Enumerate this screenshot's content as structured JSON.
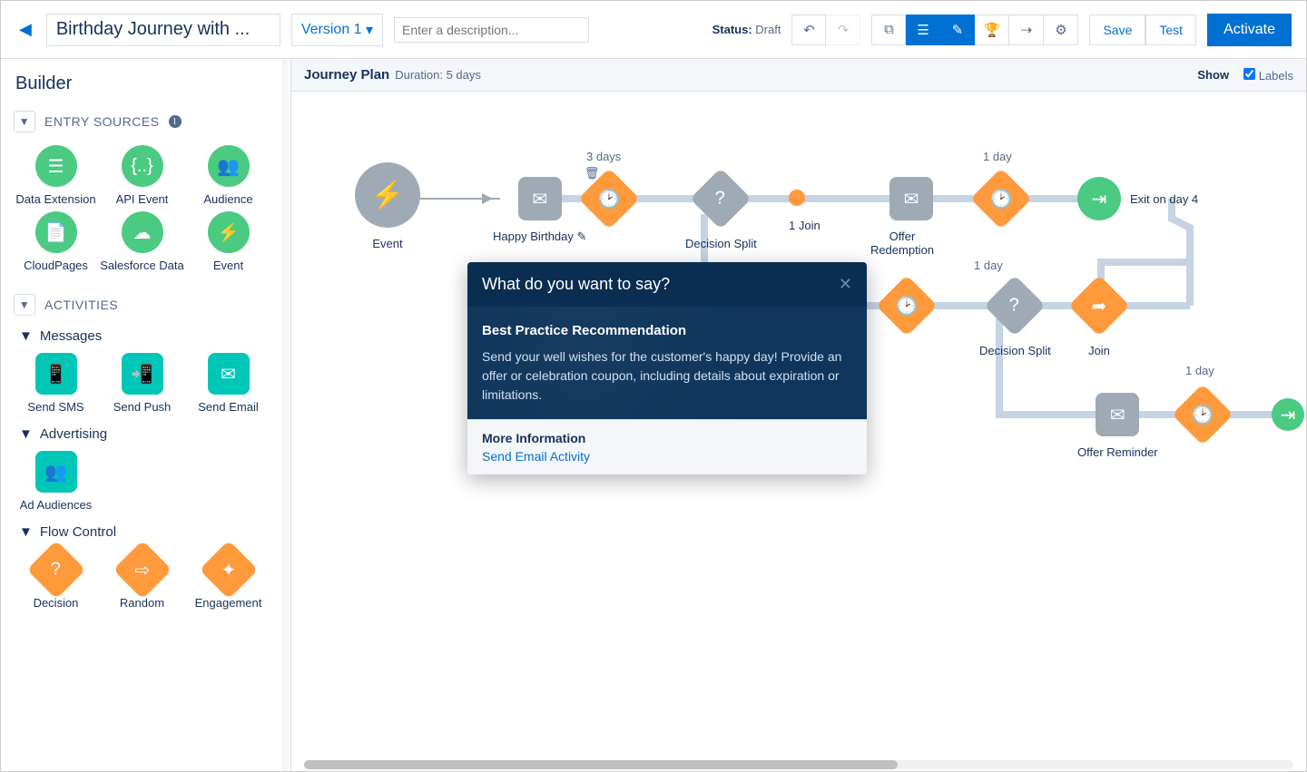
{
  "header": {
    "title": "Birthday Journey with ...",
    "version_label": "Version 1",
    "description_placeholder": "Enter a description...",
    "status_prefix": "Status:",
    "status_value": "Draft",
    "save": "Save",
    "test": "Test",
    "activate": "Activate"
  },
  "sidebar": {
    "title": "Builder",
    "entry_sources_label": "ENTRY SOURCES",
    "entry_sources": [
      {
        "label": "Data Extension",
        "icon": "list"
      },
      {
        "label": "API Event",
        "icon": "braces"
      },
      {
        "label": "Audience",
        "icon": "people"
      },
      {
        "label": "CloudPages",
        "icon": "page"
      },
      {
        "label": "Salesforce Data",
        "icon": "cloud"
      },
      {
        "label": "Event",
        "icon": "bolt"
      }
    ],
    "activities_label": "ACTIVITIES",
    "messages_label": "Messages",
    "messages": [
      {
        "label": "Send SMS",
        "icon": "sms"
      },
      {
        "label": "Send Push",
        "icon": "push"
      },
      {
        "label": "Send Email",
        "icon": "mail"
      }
    ],
    "advertising_label": "Advertising",
    "advertising": [
      {
        "label": "Ad Audiences",
        "icon": "ad"
      }
    ],
    "flow_label": "Flow Control",
    "flow": [
      {
        "label": "Decision",
        "icon": "question"
      },
      {
        "label": "Random",
        "icon": "split"
      },
      {
        "label": "Engagement",
        "icon": "spark"
      }
    ]
  },
  "canvas": {
    "title": "Journey Plan",
    "duration_label": "Duration: 5 days",
    "show": "Show",
    "labels": "Labels",
    "nodes": {
      "event": {
        "label": "Event"
      },
      "email1": {
        "label": "Happy Birthday",
        "top": "3 days"
      },
      "wait1": {
        "top": "3 days"
      },
      "split1": {
        "label": "Decision Split"
      },
      "join1": {
        "label": "1 Join"
      },
      "email2": {
        "label": "Offer Redemption"
      },
      "wait2": {
        "top": "1 day"
      },
      "exit": {
        "label": "Exit on day 4"
      },
      "wait3": {
        "top": "1 day"
      },
      "split2": {
        "label": "Decision Split"
      },
      "join2": {
        "label": "Join"
      },
      "email3": {
        "label": "Offer Reminder"
      },
      "wait4": {
        "top": "1 day"
      }
    }
  },
  "popover": {
    "title": "What do you want to say?",
    "rec_title": "Best Practice Recommendation",
    "rec_body": "Send your well wishes for the customer's happy day! Provide an offer or celebration coupon, including details about expiration or limitations.",
    "more_info": "More Information",
    "link": "Send Email Activity"
  }
}
